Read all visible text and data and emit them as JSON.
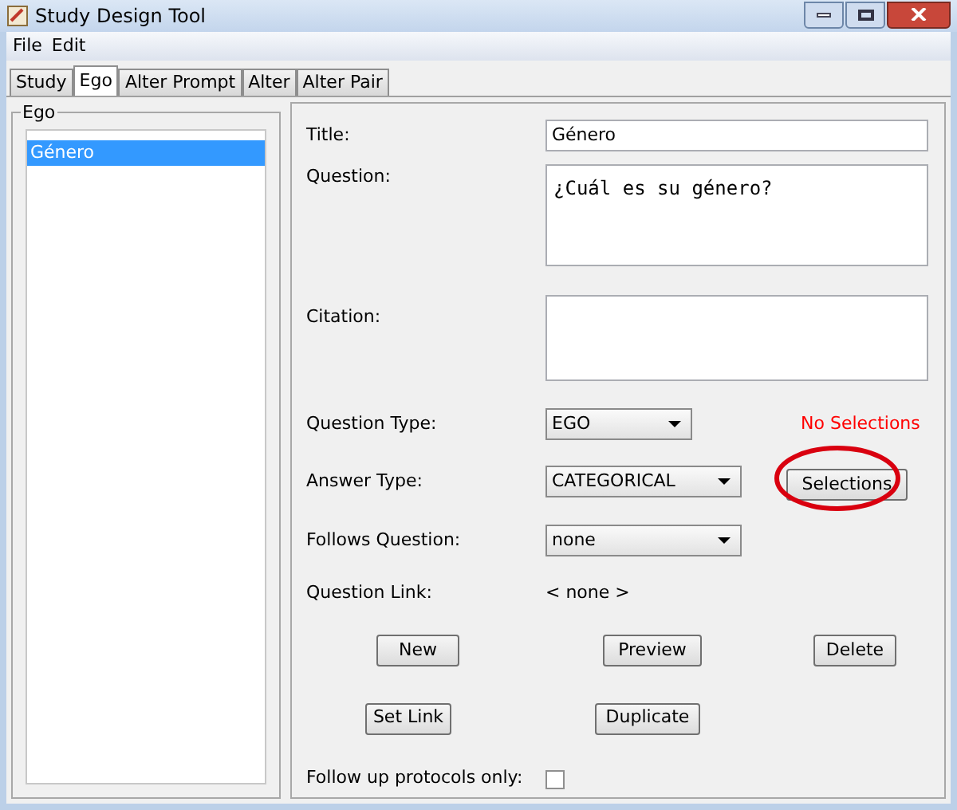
{
  "window": {
    "title": "Study Design Tool"
  },
  "menu": [
    "File",
    "Edit"
  ],
  "tabs": [
    {
      "label": "Study",
      "selected": false
    },
    {
      "label": "Ego",
      "selected": true
    },
    {
      "label": "Alter Prompt",
      "selected": false
    },
    {
      "label": "Alter",
      "selected": false
    },
    {
      "label": "Alter Pair",
      "selected": false
    }
  ],
  "sidebar": {
    "title": "Ego",
    "items": [
      {
        "label": "Género",
        "selected": true
      }
    ]
  },
  "form": {
    "title": {
      "label": "Title:",
      "value": "Género"
    },
    "question": {
      "label": "Question:",
      "value": "¿Cuál es su género?"
    },
    "citation": {
      "label": "Citation:"
    },
    "question_type": {
      "label": "Question Type:",
      "value": "EGO"
    },
    "selections_status": "No Selections",
    "answer_type": {
      "label": "Answer Type:",
      "value": "CATEGORICAL"
    },
    "selections_button": {
      "label": "Selections",
      "circled": true
    },
    "follows_question": {
      "label": "Follows Question:",
      "value": "none"
    },
    "question_link": {
      "label": "Question Link:",
      "value": "< none >"
    },
    "buttons_row_1": [
      "New",
      "Preview",
      "Delete"
    ],
    "buttons_row_2": [
      "Set Link",
      "Duplicate"
    ],
    "follow_up": {
      "label": "Follow up protocols only:",
      "checked": false
    }
  }
}
